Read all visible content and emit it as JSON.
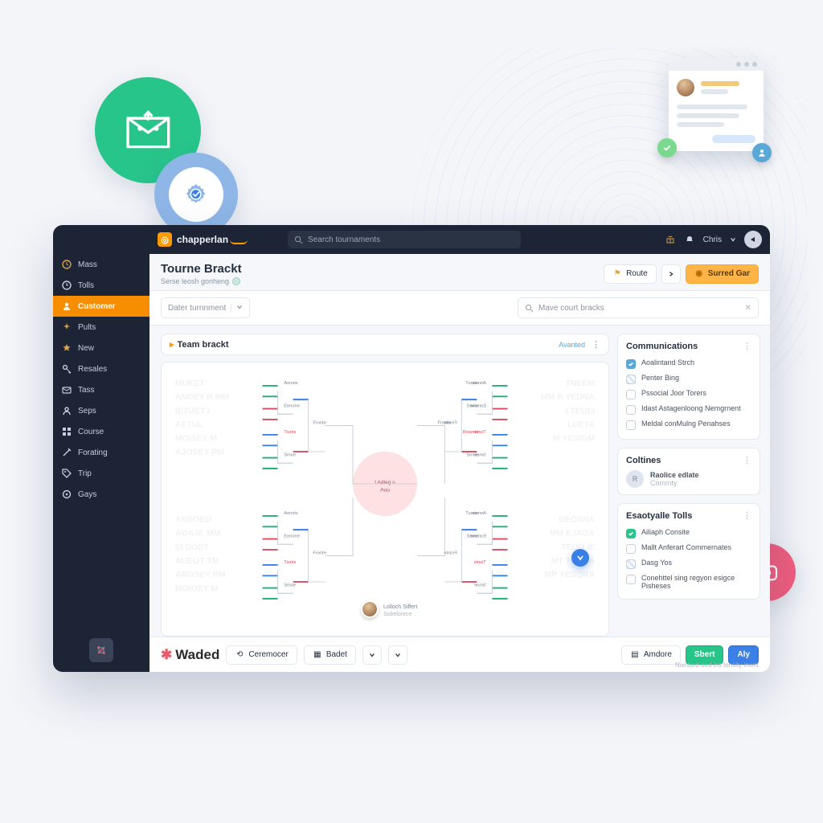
{
  "brand": "chapperlan",
  "top_search_placeholder": "Search tournaments",
  "top_user_label": "Chris",
  "sidebar": [
    {
      "icon": "bolt",
      "label": "Mass"
    },
    {
      "icon": "clock",
      "label": "Tolls"
    },
    {
      "icon": "user",
      "label": "Customer",
      "active": true
    },
    {
      "icon": "spark",
      "label": "Pults"
    },
    {
      "icon": "star",
      "label": "New"
    },
    {
      "icon": "key",
      "label": "Resales"
    },
    {
      "icon": "mail",
      "label": "Tass"
    },
    {
      "icon": "person",
      "label": "Seps"
    },
    {
      "icon": "grid",
      "label": "Course"
    },
    {
      "icon": "wand",
      "label": "Forating"
    },
    {
      "icon": "tag",
      "label": "Trip"
    },
    {
      "icon": "circle",
      "label": "Gays"
    }
  ],
  "page": {
    "title": "Tourne Brackt",
    "subtitle": "Serse leosh gonheng",
    "action_label": "Route",
    "primary_label": "Surred Gar"
  },
  "toolbar": {
    "filter_label": "Dater turnnment",
    "search_placeholder": "Mave court bracks"
  },
  "bracket_panel": {
    "title": "Team brackt",
    "status": "Avanted"
  },
  "right": {
    "comm": {
      "title": "Communications",
      "items": [
        {
          "style": "fill-blue",
          "label": "Aoalintand Strch"
        },
        {
          "style": "striped",
          "label": "Penter Bing"
        },
        {
          "style": "",
          "label": "Pssocial Joor Torers"
        },
        {
          "style": "",
          "label": "Idast Astagenloong Nemgrnent"
        },
        {
          "style": "",
          "label": "Meldal conMulng Penahses"
        }
      ]
    },
    "coll": {
      "title": "Coltines",
      "member": {
        "initials": "R",
        "line1": "Raolice edlate",
        "line2": "Commty"
      }
    },
    "tools": {
      "title": "Esaotyalle Tolls",
      "items": [
        {
          "style": "fill-teal",
          "label": "Ailiaph Consite"
        },
        {
          "style": "",
          "label": "Mallt Anferart Commernates"
        },
        {
          "style": "striped",
          "label": "Dasg Yos"
        },
        {
          "style": "",
          "label": "Conehttel sing regyon esigce Pisheses"
        }
      ]
    }
  },
  "footer": {
    "brand": "Waded",
    "btn1": "Ceremocer",
    "btn2": "Badet",
    "btn3": "Amdore",
    "btn4": "Sbert",
    "btn5": "Aly",
    "hint": "Nwntord oed ins tensity inwnt"
  },
  "bracket": {
    "labels": [
      "Aonsts",
      "Eonone",
      "Tiunts",
      "Smoe",
      "Fronte",
      "Tunae",
      "Sione",
      "Rowme"
    ],
    "final": "l Adleg s  Auu"
  }
}
